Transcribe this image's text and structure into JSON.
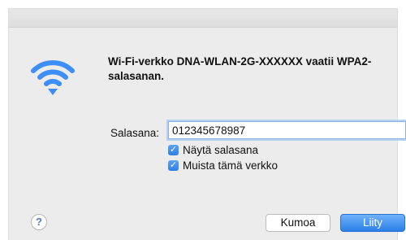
{
  "dialog": {
    "message": "Wi-Fi-verkko DNA-WLAN-2G-XXXXXX vaatii WPA2-salasanan.",
    "password_label": "Salasana:",
    "password_value": "012345678987",
    "show_password_label": "Näytä salasana",
    "show_password_checked": true,
    "remember_label": "Muista tämä verkko",
    "remember_checked": true,
    "help_glyph": "?",
    "cancel_label": "Kumoa",
    "join_label": "Liity",
    "icon": "wifi-icon",
    "colors": {
      "wifi": "#3e8ef7",
      "join_button": "#2b7fe8",
      "checkbox": "#2f7ee6"
    }
  }
}
